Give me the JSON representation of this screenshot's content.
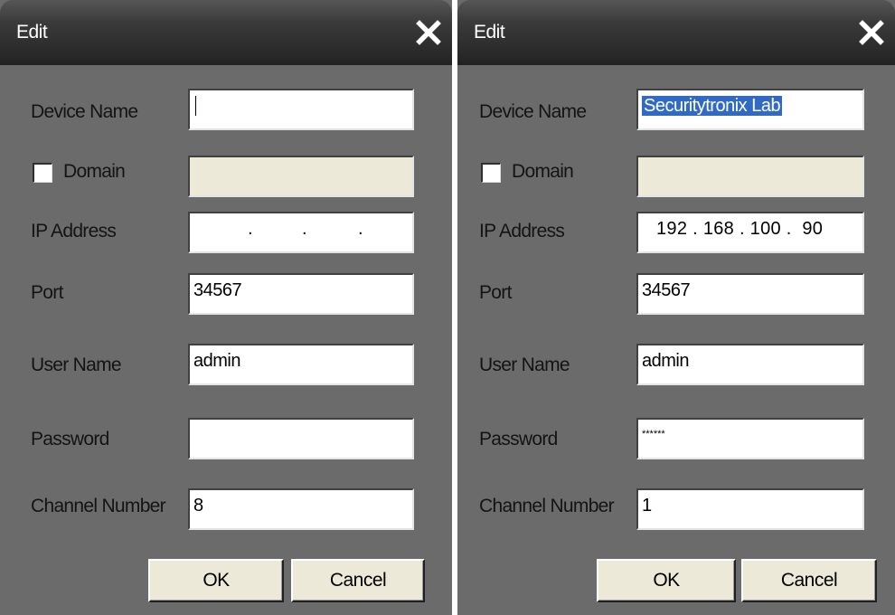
{
  "left": {
    "title": "Edit",
    "labels": {
      "device_name": "Device Name",
      "domain": "Domain",
      "ip_address": "IP Address",
      "port": "Port",
      "user_name": "User Name",
      "password": "Password",
      "channel_number": "Channel Number"
    },
    "values": {
      "device_name": "",
      "domain": "",
      "ip_address": "",
      "port": "34567",
      "user_name": "admin",
      "password": "",
      "channel_number": "8"
    },
    "domain_checked": false,
    "ok_label": "OK",
    "cancel_label": "Cancel"
  },
  "right": {
    "title": "Edit",
    "labels": {
      "device_name": "Device Name",
      "domain": "Domain",
      "ip_address": "IP Address",
      "port": "Port",
      "user_name": "User Name",
      "password": "Password",
      "channel_number": "Channel Number"
    },
    "values": {
      "device_name": "Securitytronix Lab",
      "domain": "",
      "ip_address": "192 . 168 . 100 .  90",
      "port": "34567",
      "user_name": "admin",
      "password": "******",
      "channel_number": "1"
    },
    "domain_checked": false,
    "ok_label": "OK",
    "cancel_label": "Cancel"
  },
  "icons": {
    "close": "close-icon",
    "checkbox": "checkbox-unchecked"
  },
  "colors": {
    "dialog_bg": "#6b6b6b",
    "titlebar": "#232323",
    "selection": "#316ac5",
    "button_face": "#ece9d8"
  }
}
